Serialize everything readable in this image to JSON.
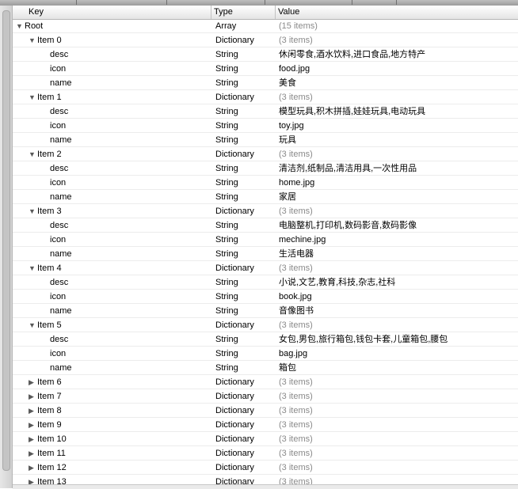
{
  "header": {
    "key": "Key",
    "type": "Type",
    "value": "Value"
  },
  "rows": [
    {
      "level": 0,
      "disclosure": "expanded",
      "key": "Root",
      "type": "Array",
      "value": "(15 items)",
      "muted": true
    },
    {
      "level": 1,
      "disclosure": "expanded",
      "key": "Item 0",
      "type": "Dictionary",
      "value": "(3 items)",
      "muted": true
    },
    {
      "level": 2,
      "disclosure": "none",
      "key": "desc",
      "type": "String",
      "value": "休闲零食,酒水饮料,进口食品,地方特产"
    },
    {
      "level": 2,
      "disclosure": "none",
      "key": "icon",
      "type": "String",
      "value": "food.jpg"
    },
    {
      "level": 2,
      "disclosure": "none",
      "key": "name",
      "type": "String",
      "value": "美食"
    },
    {
      "level": 1,
      "disclosure": "expanded",
      "key": "Item 1",
      "type": "Dictionary",
      "value": "(3 items)",
      "muted": true
    },
    {
      "level": 2,
      "disclosure": "none",
      "key": "desc",
      "type": "String",
      "value": "模型玩具,积木拼插,娃娃玩具,电动玩具"
    },
    {
      "level": 2,
      "disclosure": "none",
      "key": "icon",
      "type": "String",
      "value": "toy.jpg"
    },
    {
      "level": 2,
      "disclosure": "none",
      "key": "name",
      "type": "String",
      "value": "玩具"
    },
    {
      "level": 1,
      "disclosure": "expanded",
      "key": "Item 2",
      "type": "Dictionary",
      "value": "(3 items)",
      "muted": true
    },
    {
      "level": 2,
      "disclosure": "none",
      "key": "desc",
      "type": "String",
      "value": "清洁剂,纸制品,清洁用具,一次性用品"
    },
    {
      "level": 2,
      "disclosure": "none",
      "key": "icon",
      "type": "String",
      "value": "home.jpg"
    },
    {
      "level": 2,
      "disclosure": "none",
      "key": "name",
      "type": "String",
      "value": "家居"
    },
    {
      "level": 1,
      "disclosure": "expanded",
      "key": "Item 3",
      "type": "Dictionary",
      "value": "(3 items)",
      "muted": true
    },
    {
      "level": 2,
      "disclosure": "none",
      "key": "desc",
      "type": "String",
      "value": "电脑整机,打印机,数码影音,数码影像"
    },
    {
      "level": 2,
      "disclosure": "none",
      "key": "icon",
      "type": "String",
      "value": "mechine.jpg"
    },
    {
      "level": 2,
      "disclosure": "none",
      "key": "name",
      "type": "String",
      "value": "生活电器"
    },
    {
      "level": 1,
      "disclosure": "expanded",
      "key": "Item 4",
      "type": "Dictionary",
      "value": "(3 items)",
      "muted": true
    },
    {
      "level": 2,
      "disclosure": "none",
      "key": "desc",
      "type": "String",
      "value": "小说,文艺,教育,科技,杂志,社科"
    },
    {
      "level": 2,
      "disclosure": "none",
      "key": "icon",
      "type": "String",
      "value": "book.jpg"
    },
    {
      "level": 2,
      "disclosure": "none",
      "key": "name",
      "type": "String",
      "value": "音像图书"
    },
    {
      "level": 1,
      "disclosure": "expanded",
      "key": "Item 5",
      "type": "Dictionary",
      "value": "(3 items)",
      "muted": true
    },
    {
      "level": 2,
      "disclosure": "none",
      "key": "desc",
      "type": "String",
      "value": "女包,男包,旅行箱包,钱包卡套,儿童箱包,腰包"
    },
    {
      "level": 2,
      "disclosure": "none",
      "key": "icon",
      "type": "String",
      "value": "bag.jpg"
    },
    {
      "level": 2,
      "disclosure": "none",
      "key": "name",
      "type": "String",
      "value": "箱包"
    },
    {
      "level": 1,
      "disclosure": "collapsed",
      "key": "Item 6",
      "type": "Dictionary",
      "value": "(3 items)",
      "muted": true
    },
    {
      "level": 1,
      "disclosure": "collapsed",
      "key": "Item 7",
      "type": "Dictionary",
      "value": "(3 items)",
      "muted": true
    },
    {
      "level": 1,
      "disclosure": "collapsed",
      "key": "Item 8",
      "type": "Dictionary",
      "value": "(3 items)",
      "muted": true
    },
    {
      "level": 1,
      "disclosure": "collapsed",
      "key": "Item 9",
      "type": "Dictionary",
      "value": "(3 items)",
      "muted": true
    },
    {
      "level": 1,
      "disclosure": "collapsed",
      "key": "Item 10",
      "type": "Dictionary",
      "value": "(3 items)",
      "muted": true
    },
    {
      "level": 1,
      "disclosure": "collapsed",
      "key": "Item 11",
      "type": "Dictionary",
      "value": "(3 items)",
      "muted": true
    },
    {
      "level": 1,
      "disclosure": "collapsed",
      "key": "Item 12",
      "type": "Dictionary",
      "value": "(3 items)",
      "muted": true
    },
    {
      "level": 1,
      "disclosure": "collapsed",
      "key": "Item 13",
      "type": "Dictionary",
      "value": "(3 items)",
      "muted": true
    }
  ],
  "icons": {
    "expanded": "triangle-down-icon",
    "collapsed": "triangle-right-icon"
  },
  "colors": {
    "muted_value": "#8a8a8a",
    "disclosure": "#5a5a5a"
  }
}
